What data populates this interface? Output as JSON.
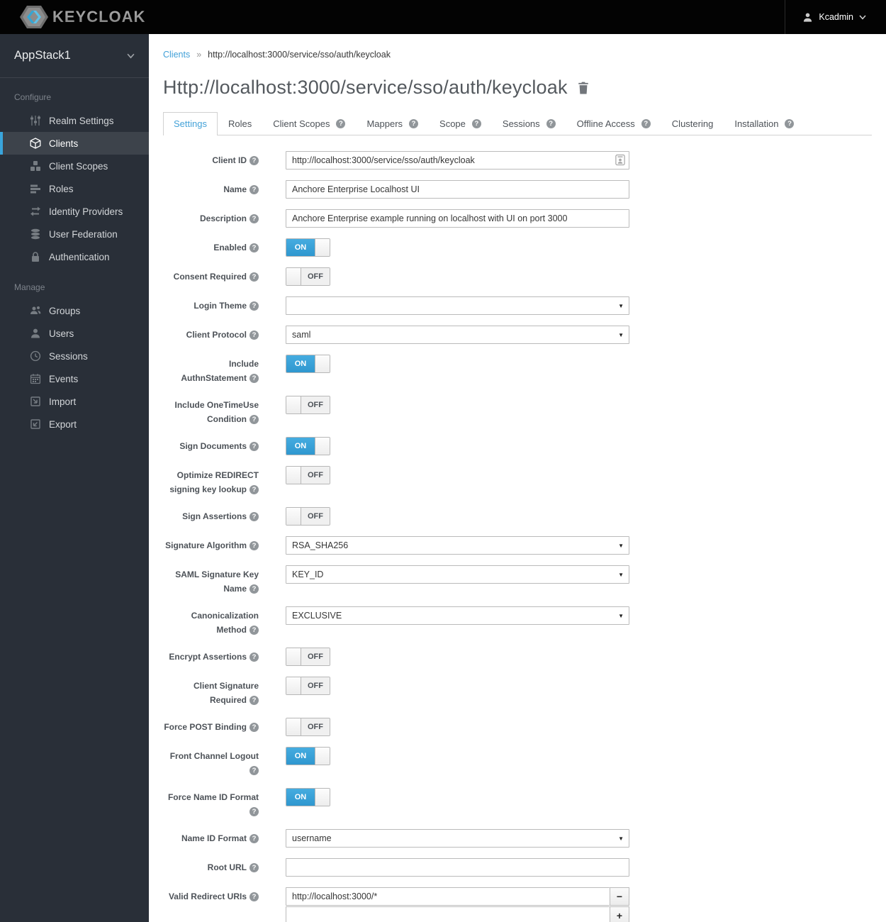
{
  "header": {
    "brand": "KEYCLOAK",
    "user_menu": {
      "label": "Kcadmin"
    }
  },
  "sidebar": {
    "realm_selector": {
      "label": "AppStack1"
    },
    "sections": [
      {
        "label": "Configure",
        "items": [
          {
            "label": "Realm Settings",
            "icon": "sliders-icon"
          },
          {
            "label": "Clients",
            "icon": "cube-icon",
            "active": true
          },
          {
            "label": "Client Scopes",
            "icon": "cubes-icon"
          },
          {
            "label": "Roles",
            "icon": "list-icon"
          },
          {
            "label": "Identity Providers",
            "icon": "swap-arrows-icon"
          },
          {
            "label": "User Federation",
            "icon": "database-icon"
          },
          {
            "label": "Authentication",
            "icon": "lock-icon"
          }
        ]
      },
      {
        "label": "Manage",
        "items": [
          {
            "label": "Groups",
            "icon": "group-icon"
          },
          {
            "label": "Users",
            "icon": "user-icon"
          },
          {
            "label": "Sessions",
            "icon": "clock-icon"
          },
          {
            "label": "Events",
            "icon": "calendar-icon"
          },
          {
            "label": "Import",
            "icon": "import-icon"
          },
          {
            "label": "Export",
            "icon": "export-icon"
          }
        ]
      }
    ]
  },
  "breadcrumb": {
    "parent": "Clients",
    "separator": "»",
    "current": "http://localhost:3000/service/sso/auth/keycloak"
  },
  "page": {
    "title": "Http://localhost:3000/service/sso/auth/keycloak"
  },
  "tabs": [
    {
      "label": "Settings",
      "active": true,
      "help": false
    },
    {
      "label": "Roles",
      "help": false
    },
    {
      "label": "Client Scopes",
      "help": true
    },
    {
      "label": "Mappers",
      "help": true
    },
    {
      "label": "Scope",
      "help": true
    },
    {
      "label": "Sessions",
      "help": true
    },
    {
      "label": "Offline Access",
      "help": true
    },
    {
      "label": "Clustering",
      "help": false
    },
    {
      "label": "Installation",
      "help": true
    }
  ],
  "icons": {
    "help_glyph": "?",
    "select_caret_glyph": "▼"
  },
  "toggle": {
    "on": "ON",
    "off": "OFF"
  },
  "form": {
    "client_id": {
      "label": "Client ID",
      "value": "http://localhost:3000/service/sso/auth/keycloak"
    },
    "name": {
      "label": "Name",
      "value": "Anchore Enterprise Localhost UI"
    },
    "description": {
      "label": "Description",
      "value": "Anchore Enterprise example running on localhost with UI on port 3000"
    },
    "enabled": {
      "label": "Enabled",
      "state": "ON"
    },
    "consent_required": {
      "label": "Consent Required",
      "state": "OFF"
    },
    "login_theme": {
      "label": "Login Theme",
      "value": ""
    },
    "client_protocol": {
      "label": "Client Protocol",
      "value": "saml"
    },
    "include_authn_statement": {
      "label": "Include AuthnStatement",
      "state": "ON"
    },
    "include_onetimeuse_condition": {
      "label": "Include OneTimeUse Condition",
      "state": "OFF"
    },
    "sign_documents": {
      "label": "Sign Documents",
      "state": "ON"
    },
    "optimize_redirect": {
      "label": "Optimize REDIRECT signing key lookup",
      "state": "OFF"
    },
    "sign_assertions": {
      "label": "Sign Assertions",
      "state": "OFF"
    },
    "signature_algorithm": {
      "label": "Signature Algorithm",
      "value": "RSA_SHA256"
    },
    "saml_signature_key_name": {
      "label": "SAML Signature Key Name",
      "value": "KEY_ID"
    },
    "canonicalization_method": {
      "label": "Canonicalization Method",
      "value": "EXCLUSIVE"
    },
    "encrypt_assertions": {
      "label": "Encrypt Assertions",
      "state": "OFF"
    },
    "client_signature_required": {
      "label": "Client Signature Required",
      "state": "OFF"
    },
    "force_post_binding": {
      "label": "Force POST Binding",
      "state": "OFF"
    },
    "front_channel_logout": {
      "label": "Front Channel Logout",
      "state": "ON"
    },
    "force_name_id_format": {
      "label": "Force Name ID Format",
      "state": "ON"
    },
    "name_id_format": {
      "label": "Name ID Format",
      "value": "username"
    },
    "root_url": {
      "label": "Root URL",
      "value": ""
    },
    "valid_redirect_uris": {
      "label": "Valid Redirect URIs",
      "values": [
        "http://localhost:3000/*"
      ],
      "new_value": "",
      "remove_glyph": "−",
      "add_glyph": "+"
    }
  },
  "colors": {
    "accent_blue": "#39a5dc",
    "sidebar_bg": "#292f38",
    "header_bg": "#030303",
    "link_blue": "#41a0d8"
  }
}
